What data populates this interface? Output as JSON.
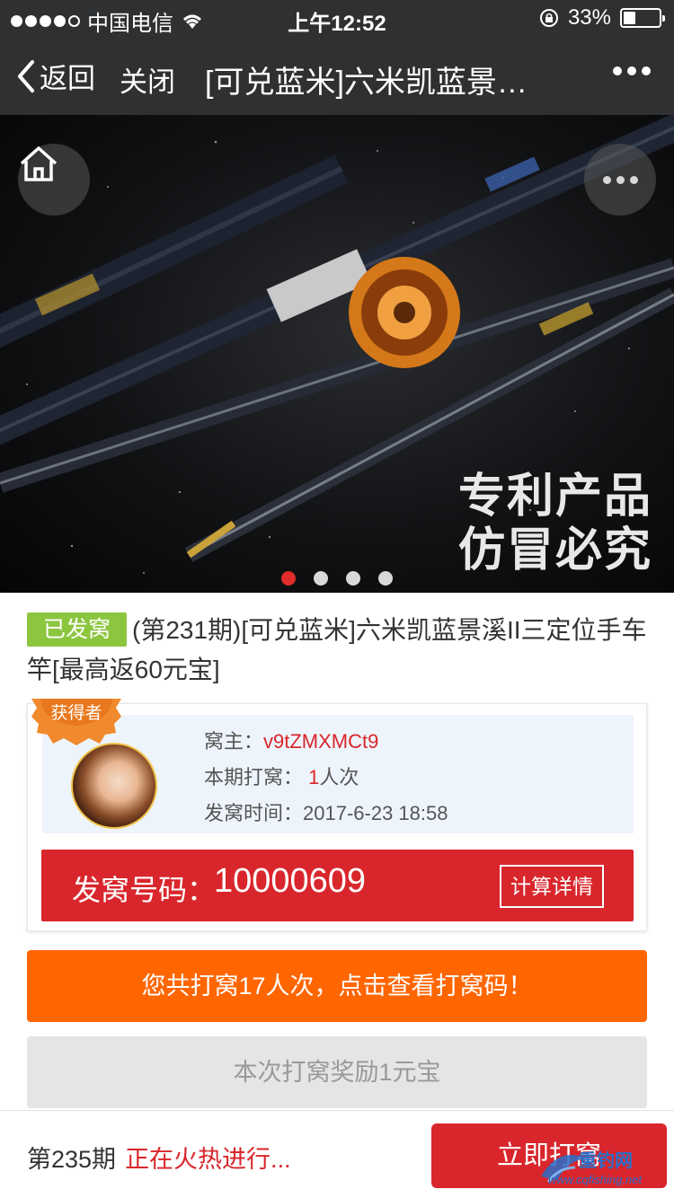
{
  "status_bar": {
    "carrier": "中国电信",
    "time": "上午12:52",
    "battery": "33%",
    "battery_level": 0.33
  },
  "nav": {
    "back_label": "返回",
    "close_label": "关闭",
    "title": "[可兑蓝米]六米凯蓝景…"
  },
  "banner": {
    "promo_line1": "专利产品",
    "promo_line2": "仿冒必究",
    "page_count": 4,
    "active_page": 1
  },
  "product": {
    "status_tag": "已发窝",
    "title": "(第231期)[可兑蓝米]六米凯蓝景溪II三定位手车竿[最高返60元宝]"
  },
  "winner": {
    "badge": "获得者",
    "owner_label": "窝主：",
    "owner_value": "v9tZMXMCt9",
    "times_label": "本期打窝：",
    "times_value": "1",
    "times_unit": "人次",
    "time_label": "发窝时间：",
    "time_value": "2017-6-23 18:58"
  },
  "code": {
    "label": "发窝号码：",
    "value": "10000609",
    "calc_button": "计算详情"
  },
  "actions": {
    "view_codes": "您共打窝17人次，点击查看打窝码！",
    "reward": "本次打窝奖励1元宝"
  },
  "bottom": {
    "period": "第235期",
    "status": "正在火热进行...",
    "join_button": "立即打窝"
  },
  "watermark": {
    "name": "重钓网",
    "url": "www.cqfishing.net"
  },
  "colors": {
    "nav_bg": "#2e3032",
    "red": "#d9262c",
    "orange": "#ff6600",
    "green": "#8cc63f"
  }
}
